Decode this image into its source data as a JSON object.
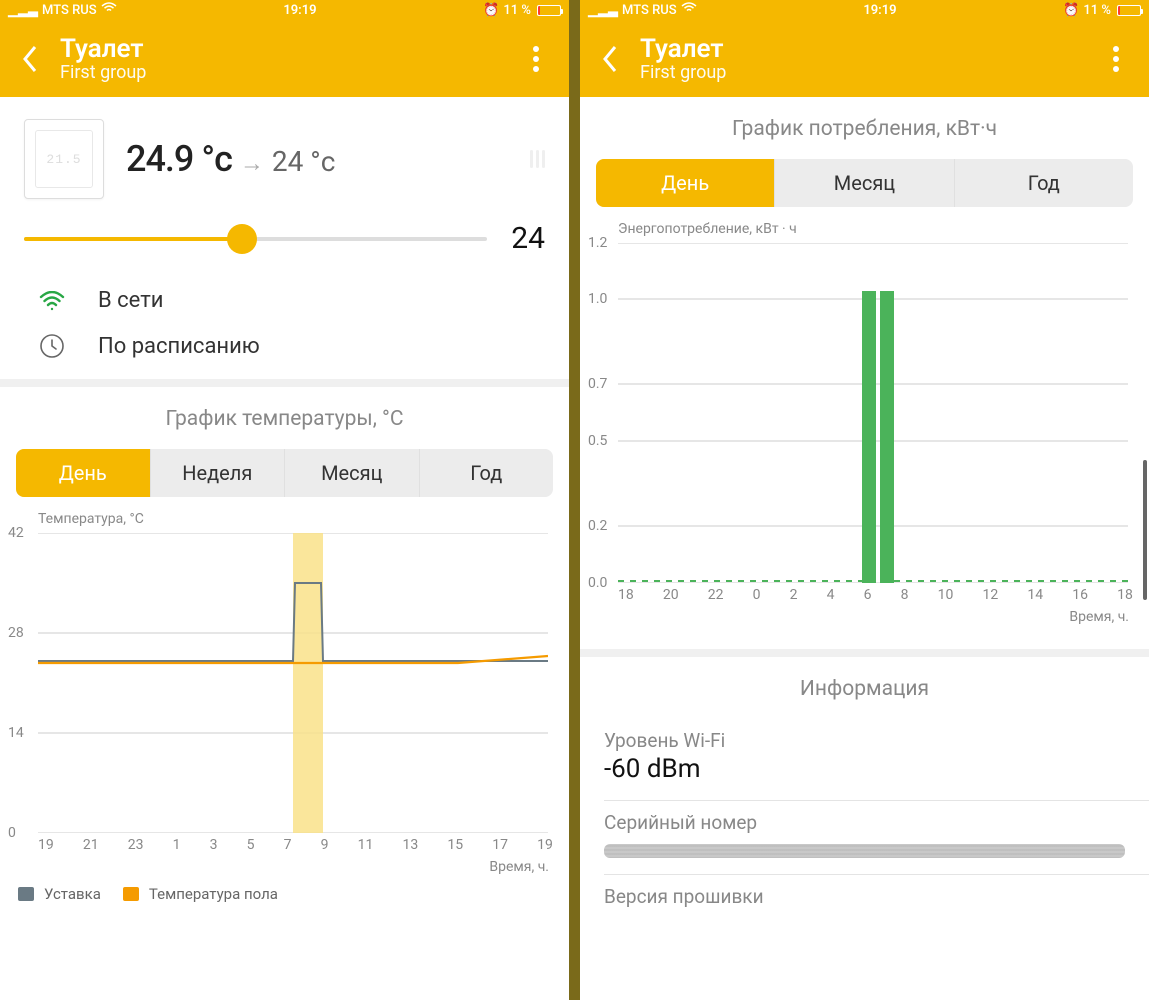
{
  "status_bar": {
    "carrier": "MTS RUS",
    "time": "19:19",
    "battery_text": "11 %"
  },
  "header": {
    "title": "Туалет",
    "subtitle": "First group"
  },
  "left": {
    "temp_current": "24.9 °с",
    "temp_target_inline": "24 °с",
    "slider_value": "24",
    "status_network": "В сети",
    "status_mode": "По расписанию",
    "section_title": "График температуры, °С",
    "tabs": {
      "day": "День",
      "week": "Неделя",
      "month": "Месяц",
      "year": "Год"
    },
    "chart_caption": "Температура, °С",
    "yticks": [
      "42",
      "28",
      "14",
      "0"
    ],
    "xaxis_label": "Время, ч.",
    "legend": {
      "setpoint": "Уставка",
      "floor_temp": "Температура пола"
    }
  },
  "right": {
    "section_title": "График потребления, кВт·ч",
    "tabs": {
      "day": "День",
      "month": "Месяц",
      "year": "Год"
    },
    "chart_caption": "Энергопотребление, кВт · ч",
    "yticks": [
      "1.2",
      "1.0",
      "0.7",
      "0.5",
      "0.2",
      "0.0"
    ],
    "xaxis_label": "Время, ч.",
    "info_title": "Информация",
    "wifi_label": "Уровень Wi-Fi",
    "wifi_value": "-60 dBm",
    "serial_label": "Серийный номер",
    "fw_label": "Версия прошивки"
  },
  "chart_data": [
    {
      "id": "temperature_chart",
      "type": "line",
      "title": "График температуры, °С",
      "xlabel": "Время, ч.",
      "ylabel": "Температура, °С",
      "ylim": [
        0,
        42
      ],
      "x": [
        19,
        21,
        23,
        1,
        3,
        5,
        7,
        9,
        11,
        13,
        15,
        17,
        19
      ],
      "series": [
        {
          "name": "Уставка",
          "color": "#6a7a84",
          "values": [
            24,
            24,
            24,
            24,
            24,
            24,
            35,
            24,
            24,
            24,
            24,
            24,
            24
          ]
        },
        {
          "name": "Температура пола",
          "color": "#f59b00",
          "values": [
            24,
            24,
            24,
            24,
            24,
            24,
            24,
            24,
            24,
            24,
            24,
            25,
            25
          ]
        }
      ],
      "highlight_band_x": [
        7,
        8
      ]
    },
    {
      "id": "consumption_chart",
      "type": "bar",
      "title": "График потребления, кВт·ч",
      "xlabel": "Время, ч.",
      "ylabel": "Энергопотребление, кВт · ч",
      "ylim": [
        0,
        1.2
      ],
      "x": [
        18,
        20,
        22,
        0,
        2,
        4,
        6,
        8,
        10,
        12,
        14,
        16,
        18
      ],
      "series": [
        {
          "name": "Энергопотребление",
          "color": "#4bb35a",
          "values": [
            0,
            0,
            0,
            0,
            0,
            0,
            1.03,
            1.03,
            0,
            0,
            0,
            0,
            0
          ]
        }
      ]
    }
  ]
}
